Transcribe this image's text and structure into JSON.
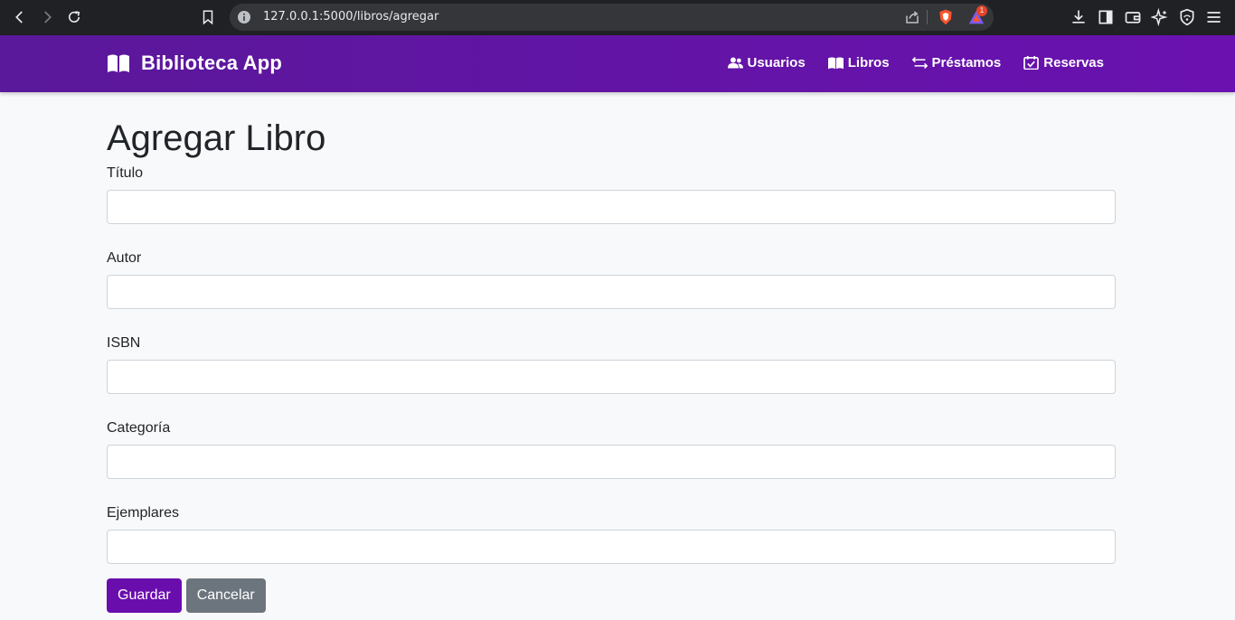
{
  "browser": {
    "url": "127.0.0.1:5000/libros/agregar",
    "rewards_badge": "1"
  },
  "navbar": {
    "brand": "Biblioteca App",
    "links": [
      {
        "label": "Usuarios",
        "icon": "users-icon"
      },
      {
        "label": "Libros",
        "icon": "book-icon"
      },
      {
        "label": "Préstamos",
        "icon": "exchange-icon"
      },
      {
        "label": "Reservas",
        "icon": "calendar-check-icon"
      }
    ]
  },
  "page": {
    "title": "Agregar Libro"
  },
  "form": {
    "fields": [
      {
        "label": "Título",
        "value": ""
      },
      {
        "label": "Autor",
        "value": ""
      },
      {
        "label": "ISBN",
        "value": ""
      },
      {
        "label": "Categoría",
        "value": ""
      },
      {
        "label": "Ejemplares",
        "value": ""
      }
    ],
    "save_label": "Guardar",
    "cancel_label": "Cancelar"
  },
  "colors": {
    "navbar": "#5a189a",
    "primary": "#6a0dad",
    "secondary": "#6c757d",
    "background": "#f8f9fa"
  }
}
